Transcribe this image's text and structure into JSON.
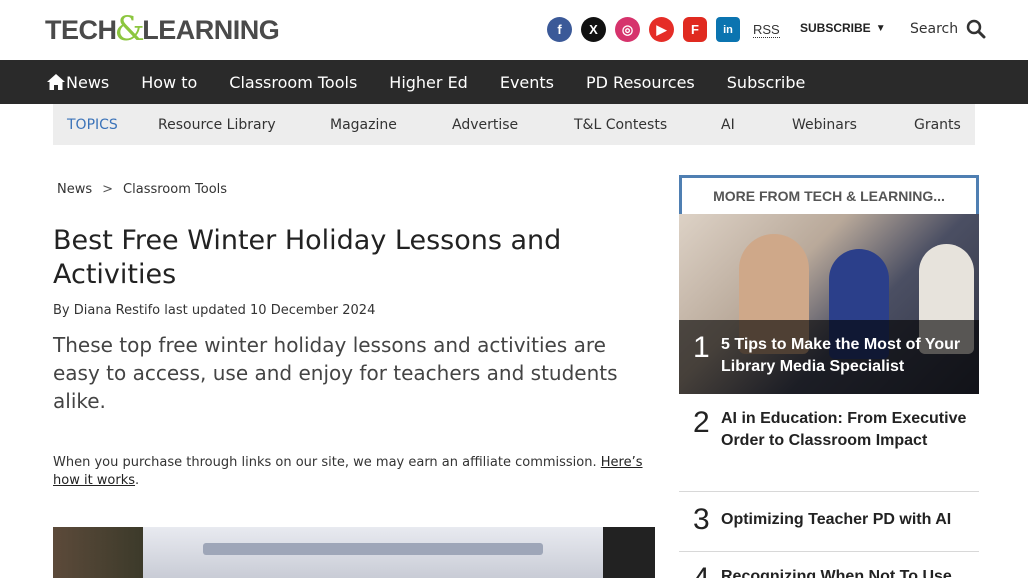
{
  "header": {
    "logo_part1": "TECH",
    "logo_amp": "&",
    "logo_part2": "LEARNING",
    "social": [
      {
        "name": "facebook",
        "glyph": "f"
      },
      {
        "name": "x",
        "glyph": "X"
      },
      {
        "name": "instagram",
        "glyph": "◎"
      },
      {
        "name": "youtube",
        "glyph": "▶"
      },
      {
        "name": "flipboard",
        "glyph": "F"
      },
      {
        "name": "linkedin",
        "glyph": "in"
      }
    ],
    "rss_label": "RSS",
    "subscribe_label": "SUBSCRIBE",
    "search_label": "Search"
  },
  "nav": {
    "items": [
      "News",
      "How to",
      "Classroom Tools",
      "Higher Ed",
      "Events",
      "PD Resources",
      "Subscribe"
    ]
  },
  "topics": {
    "lead": "TOPICS",
    "items": [
      "Resource Library",
      "Magazine",
      "Advertise",
      "T&L Contests",
      "AI",
      "Webinars",
      "Grants"
    ]
  },
  "breadcrumb": {
    "items": [
      "News",
      "Classroom Tools"
    ],
    "separator": ">"
  },
  "article": {
    "title": "Best Free Winter Holiday Lessons and Activities",
    "byline": "By Diana Restifo last updated 10 December 2024",
    "strapline": "These top free winter holiday lessons and activities are easy to access, use and enjoy for teachers and students alike.",
    "affiliate_text": "When you purchase through links on our site, we may earn an affiliate commission.",
    "affiliate_link": "Here’s how it works",
    "affiliate_end": "."
  },
  "sidebar": {
    "heading": "MORE FROM TECH & LEARNING...",
    "items": [
      {
        "rank": "1",
        "title": "5 Tips to Make the Most of Your Library Media Specialist"
      },
      {
        "rank": "2",
        "title": "AI in Education: From Executive Order to Classroom Impact"
      },
      {
        "rank": "3",
        "title": "Optimizing Teacher PD with AI"
      },
      {
        "rank": "4",
        "title": "Recognizing When Not To Use"
      }
    ]
  }
}
